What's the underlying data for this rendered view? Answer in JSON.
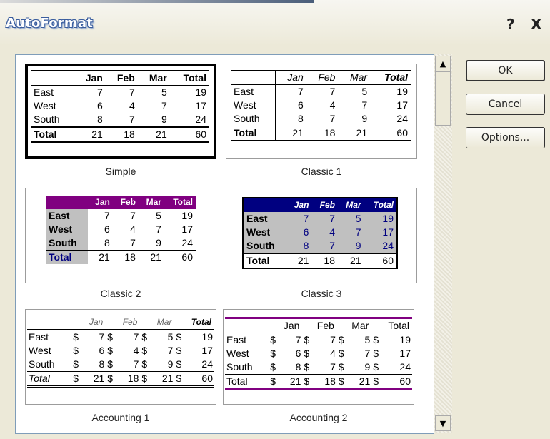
{
  "window": {
    "title": "AutoFormat",
    "help": "?",
    "close": "X"
  },
  "buttons": {
    "ok": "OK",
    "cancel": "Cancel",
    "options": "Options..."
  },
  "formats": [
    {
      "name": "Simple",
      "header": [
        "",
        "Jan",
        "Feb",
        "Mar",
        "Total"
      ],
      "rows": [
        [
          "East",
          "7",
          "7",
          "5",
          "19"
        ],
        [
          "West",
          "6",
          "4",
          "7",
          "17"
        ],
        [
          "South",
          "8",
          "7",
          "9",
          "24"
        ],
        [
          "Total",
          "21",
          "18",
          "21",
          "60"
        ]
      ]
    },
    {
      "name": "Classic 1",
      "header": [
        "",
        "Jan",
        "Feb",
        "Mar",
        "Total"
      ],
      "rows": [
        [
          "East",
          "7",
          "7",
          "5",
          "19"
        ],
        [
          "West",
          "6",
          "4",
          "7",
          "17"
        ],
        [
          "South",
          "8",
          "7",
          "9",
          "24"
        ],
        [
          "Total",
          "21",
          "18",
          "21",
          "60"
        ]
      ]
    },
    {
      "name": "Classic 2",
      "header": [
        "",
        "Jan",
        "Feb",
        "Mar",
        "Total"
      ],
      "rows": [
        [
          "East",
          "7",
          "7",
          "5",
          "19"
        ],
        [
          "West",
          "6",
          "4",
          "7",
          "17"
        ],
        [
          "South",
          "8",
          "7",
          "9",
          "24"
        ],
        [
          "Total",
          "21",
          "18",
          "21",
          "60"
        ]
      ]
    },
    {
      "name": "Classic 3",
      "header": [
        "",
        "Jan",
        "Feb",
        "Mar",
        "Total"
      ],
      "rows": [
        [
          "East",
          "7",
          "7",
          "5",
          "19"
        ],
        [
          "West",
          "6",
          "4",
          "7",
          "17"
        ],
        [
          "South",
          "8",
          "7",
          "9",
          "24"
        ],
        [
          "Total",
          "21",
          "18",
          "21",
          "60"
        ]
      ]
    },
    {
      "name": "Accounting 1",
      "header": [
        "",
        "Jan",
        "Feb",
        "Mar",
        "Total"
      ],
      "rows": [
        [
          "East",
          "7",
          "7",
          "5",
          "19"
        ],
        [
          "West",
          "6",
          "4",
          "7",
          "17"
        ],
        [
          "South",
          "8",
          "7",
          "9",
          "24"
        ],
        [
          "Total",
          "21",
          "18",
          "21",
          "60"
        ]
      ]
    },
    {
      "name": "Accounting 2",
      "header": [
        "",
        "Jan",
        "Feb",
        "Mar",
        "Total"
      ],
      "rows": [
        [
          "East",
          "7",
          "7",
          "5",
          "19"
        ],
        [
          "West",
          "6",
          "4",
          "7",
          "17"
        ],
        [
          "South",
          "8",
          "7",
          "9",
          "24"
        ],
        [
          "Total",
          "21",
          "18",
          "21",
          "60"
        ]
      ]
    }
  ],
  "currency_symbol": "$",
  "colors": {
    "classic2_header": "#800080",
    "classic3_header": "#000080",
    "classic3_body": "#c0c0c0",
    "accounting2_rule": "#800080"
  }
}
